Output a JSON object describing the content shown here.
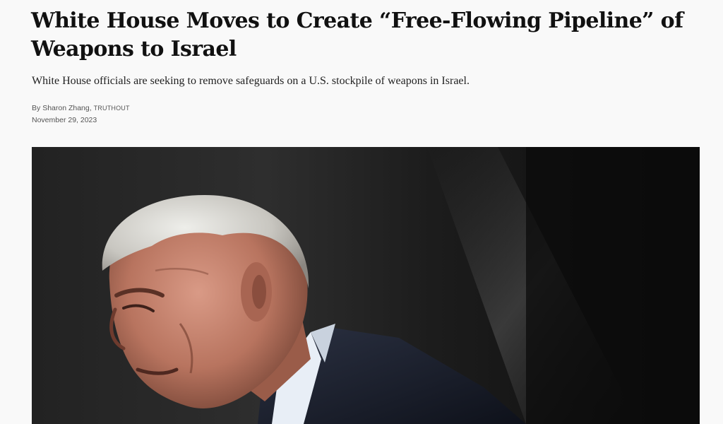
{
  "article": {
    "headline": "White House Moves to Create “Free-Flowing Pipeline” of Weapons to Israel",
    "dek": "White House officials are seeking to remove safeguards on a U.S. stockpile of weapons in Israel.",
    "byline": {
      "prefix": "By",
      "author": "Sharon Zhang",
      "separator": ",",
      "outlet": "TRUTHOUT"
    },
    "date": "November 29, 2023"
  },
  "hero_image": {
    "subject": "photo of a white-haired older man in a dark suit, head bowed, against a dark background"
  },
  "colors": {
    "page_background": "#f9f9f9",
    "headline_text": "#111111",
    "meta_text": "#555555"
  }
}
